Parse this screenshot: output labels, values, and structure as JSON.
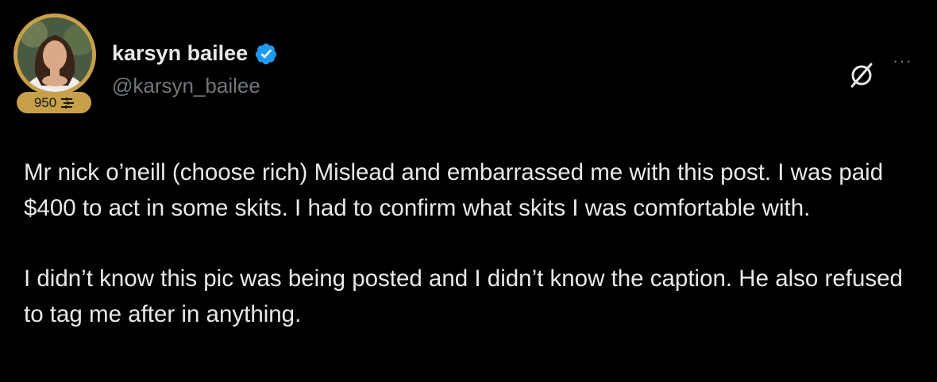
{
  "author": {
    "display_name": "karsyn bailee",
    "handle": "@karsyn_bailee",
    "badge_count": "950",
    "verified": true
  },
  "post": {
    "paragraphs": [
      "Mr nick o’neill (choose rich) Mislead and embarrassed me with this post. I was paid $400 to act in some skits. I had to confirm what skits I was comfortable with.",
      "I didn’t know this pic was being posted and I didn’t know the caption. He also refused to tag me after in anything."
    ]
  },
  "actions": {
    "more_label": "···"
  },
  "colors": {
    "background": "#000000",
    "text": "#e7e9ea",
    "secondary": "#71767b",
    "gold": "#c8a04a",
    "verified": "#1d9bf0"
  },
  "icons": [
    "verified-icon",
    "grok-icon",
    "more-icon",
    "badge-icon"
  ]
}
